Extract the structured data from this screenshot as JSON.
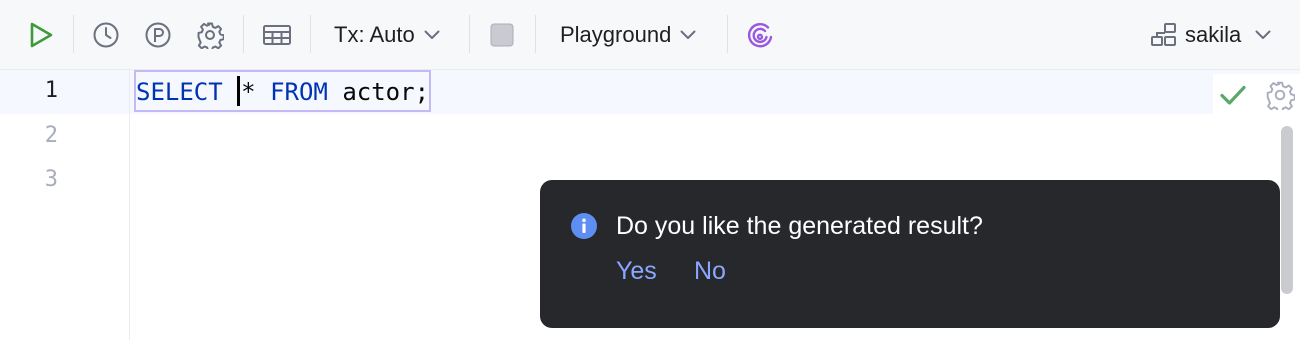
{
  "toolbar": {
    "run_icon": "run-icon",
    "history_icon": "history-icon",
    "pin_icon": "pin-p-icon",
    "settings_icon": "gear-icon",
    "table_icon": "table-icon",
    "tx_label": "Tx: Auto",
    "stop_icon": "stop-icon",
    "mode_label": "Playground",
    "ai_icon": "ai-assistant-icon",
    "schema_icon": "schema-icon",
    "schema_label": "sakila",
    "colors": {
      "run": "#3e9a3a",
      "ai": "#9a58e0"
    }
  },
  "editor": {
    "line_numbers": [
      "1",
      "2",
      "3"
    ],
    "code": {
      "select_kw": "SELECT",
      "star": "*",
      "from_kw": "FROM",
      "table": "actor",
      "semicolon": ";"
    },
    "status_icon": "check-icon",
    "status_color": "#59a869"
  },
  "popup": {
    "icon": "info-icon",
    "message": "Do you like the generated result?",
    "yes_label": "Yes",
    "no_label": "No",
    "link_color": "#8aa7ff"
  }
}
